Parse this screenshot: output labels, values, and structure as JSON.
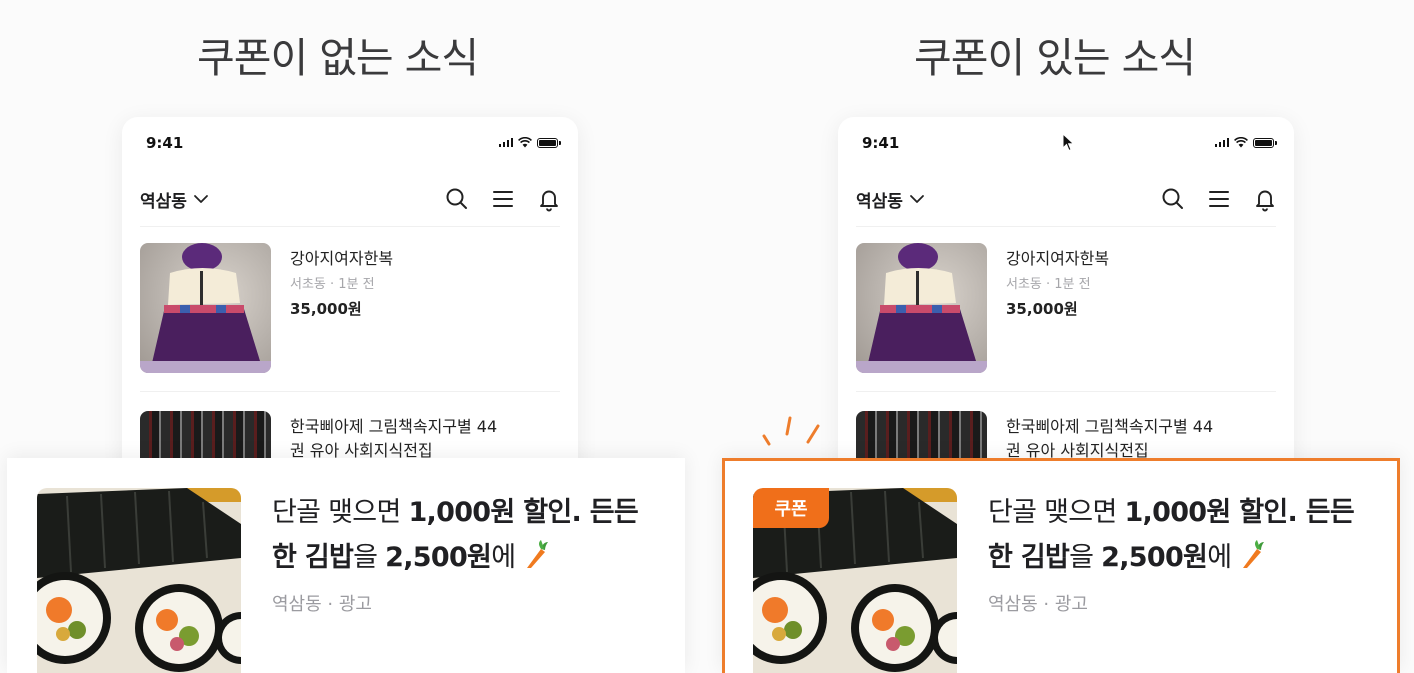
{
  "titles": {
    "left": "쿠폰이 없는 소식",
    "right": "쿠폰이 있는 소식"
  },
  "phone": {
    "time": "9:41",
    "location": "역삼동",
    "icons": [
      "signal-icon",
      "wifi-icon",
      "battery-icon",
      "chevron-down-icon",
      "search-icon",
      "menu-icon",
      "bell-icon"
    ]
  },
  "items": [
    {
      "title": "강아지여자한복",
      "meta": "서초동 · 1분 전",
      "price": "35,000원"
    },
    {
      "title": "한국삐아제 그림책속지구별 44",
      "title_line2": "권 유아 사회지식전집"
    }
  ],
  "ad": {
    "title_prefix": "단골 맺으면 ",
    "title_bold_1": "1,000원 할인. 든든",
    "title_bold_2": "한 김밥",
    "title_mid": "을 ",
    "title_bold_3": "2,500원",
    "title_suffix": "에",
    "meta": "역삼동 · 광고",
    "badge": "쿠폰"
  },
  "colors": {
    "accent": "#ee7d2c",
    "badge": "#f06f1a"
  }
}
